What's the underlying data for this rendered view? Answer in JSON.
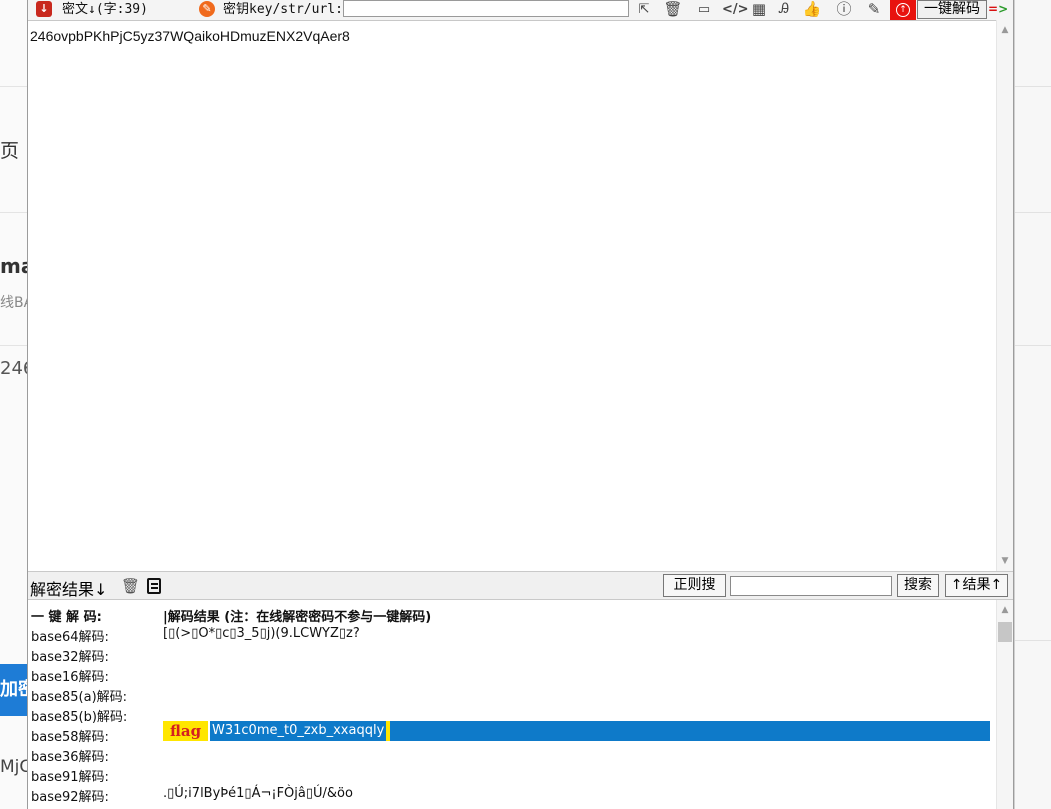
{
  "background": {
    "fragments": [
      "页",
      "ma",
      "线BA",
      "246",
      "加密",
      "MjC"
    ]
  },
  "toolbar": {
    "cipher_label": "密文↓(字:39)",
    "key_label": "密钥key/str/url:",
    "key_value": "",
    "decode_all_label": "一键解码",
    "icons": [
      "cursor-icon",
      "trash-icon",
      "console-icon",
      "code-icon",
      "table-icon",
      "font-icon",
      "thumbs-up-icon",
      "help-icon",
      "edit-icon"
    ]
  },
  "cipher_text": "246ovpbPKhPjC5yz37WQaikoHDmuzENX2VqAer8",
  "result_bar": {
    "label": "解密结果↓",
    "regex_search_label": "正则搜",
    "search_value": "",
    "search_label": "搜索",
    "to_result_label": "↑结果↑"
  },
  "results": {
    "header_label": "一 键 解 码:",
    "header_value": "|解码结果 (注：在线解密密码不参与一键解码)",
    "rows": [
      {
        "label": "base64解码:",
        "value": "[▯(>▯O*▯c▯3_5▯j)(9.LCWYZ▯z?"
      },
      {
        "label": "base32解码:",
        "value": ""
      },
      {
        "label": "base16解码:",
        "value": ""
      },
      {
        "label": "base85(a)解码:",
        "value": ""
      },
      {
        "label": "base85(b)解码:",
        "value": ""
      },
      {
        "label": "base58解码:",
        "value": "",
        "flag_tag": "flag",
        "flag_text": "W31c0me_t0_zxb_xxaqqly"
      },
      {
        "label": "base36解码:",
        "value": ""
      },
      {
        "label": "base91解码:",
        "value": ""
      },
      {
        "label": "base92解码:",
        "value": ".▯Ú;i7lByÞé1▯Á¬¡FÒjâ▯Ú/&öo"
      }
    ]
  },
  "colors": {
    "highlight_blue": "#0e7ac9",
    "flag_yellow": "#ffe600",
    "flag_red": "#d42020",
    "accent_red_button": "#e8130e"
  }
}
